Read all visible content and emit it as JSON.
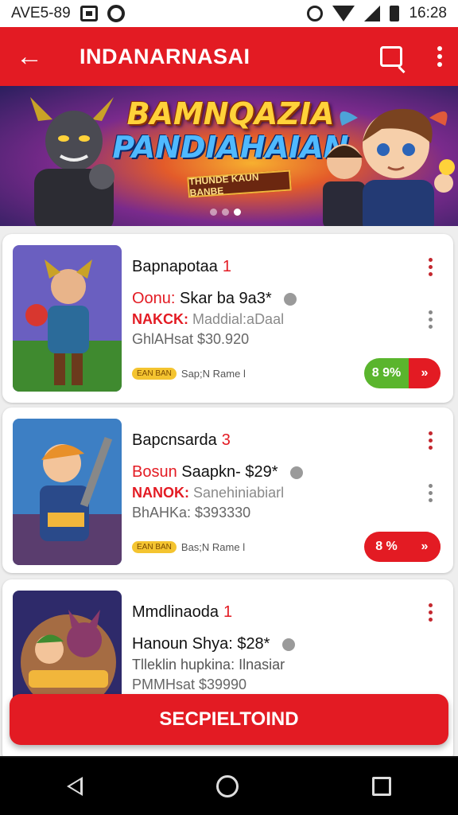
{
  "status_bar": {
    "left_text": "AVE5-89",
    "time": "16:28"
  },
  "app_bar": {
    "back_icon": "arrow-left-icon",
    "title": "INDANARNASAI",
    "chat_icon": "chat-icon",
    "menu_icon": "more-vert-icon"
  },
  "banner": {
    "title_line1": "BAMNQAZIA",
    "title_line2": "PANDIAHAIAN",
    "ribbon": "THUNDE KAUN BANBE",
    "page_count": 3,
    "active_page": 3
  },
  "cards": [
    {
      "title": "Bapnapotaa",
      "title_num": "1",
      "line1_prefix": "Oonu:",
      "line1_text": "Skar ba 9a3*",
      "line2_prefix": "NAKCK:",
      "line2_text": "Maddial:aDaal",
      "line3": "GhlAHsat $30.920",
      "tag": "EAN BAN",
      "badge_text": "Sap;N Rame l",
      "price_pct": "8 9%",
      "price_color": "#5ab52d"
    },
    {
      "title": "Bapcnsarda",
      "title_num": "3",
      "line1_prefix": "Bosun",
      "line1_text": "Saapkn- $29*",
      "line2_prefix": "NANOK:",
      "line2_text": "Sanehiniabiarl",
      "line3": "BhAHKa: $393330",
      "tag": "EAN BAN",
      "badge_text": "Bas;N Rame l",
      "price_pct": "8 %",
      "price_color": "#e31b23"
    },
    {
      "title": "Mmdlinaoda",
      "title_num": "1",
      "line1_prefix": "",
      "line1_text": "Hanoun Shya: $28*",
      "line2_prefix": "",
      "line2_text": "Tlleklin hupkina: Ilnasiar",
      "line3": "PMMHsat $39990",
      "tag": "",
      "badge_text": "",
      "price_pct": "",
      "price_color": ""
    }
  ],
  "cta": {
    "label": "SECPIELTOIND"
  },
  "colors": {
    "brand_red": "#e31b23",
    "green": "#5ab52d"
  }
}
